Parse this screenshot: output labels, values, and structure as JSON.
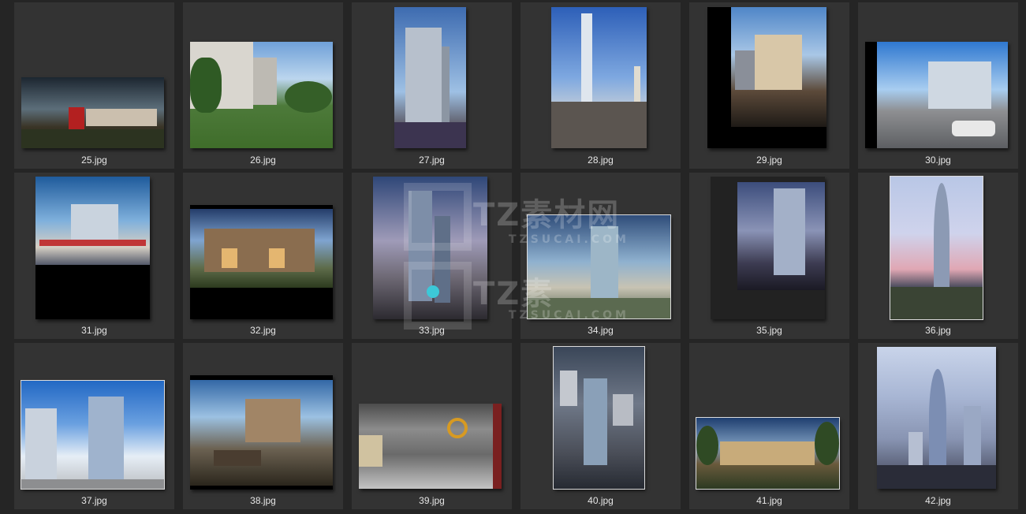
{
  "files": [
    {
      "name": "25.jpg"
    },
    {
      "name": "26.jpg"
    },
    {
      "name": "27.jpg"
    },
    {
      "name": "28.jpg"
    },
    {
      "name": "29.jpg"
    },
    {
      "name": "30.jpg"
    },
    {
      "name": "31.jpg"
    },
    {
      "name": "32.jpg"
    },
    {
      "name": "33.jpg"
    },
    {
      "name": "34.jpg"
    },
    {
      "name": "35.jpg"
    },
    {
      "name": "36.jpg"
    },
    {
      "name": "37.jpg"
    },
    {
      "name": "38.jpg"
    },
    {
      "name": "39.jpg"
    },
    {
      "name": "40.jpg"
    },
    {
      "name": "41.jpg"
    },
    {
      "name": "42.jpg"
    }
  ],
  "watermark": {
    "brand": "TZ素材网",
    "domain": "TZSUCAI.COM",
    "brand_partial": "TZ素"
  }
}
